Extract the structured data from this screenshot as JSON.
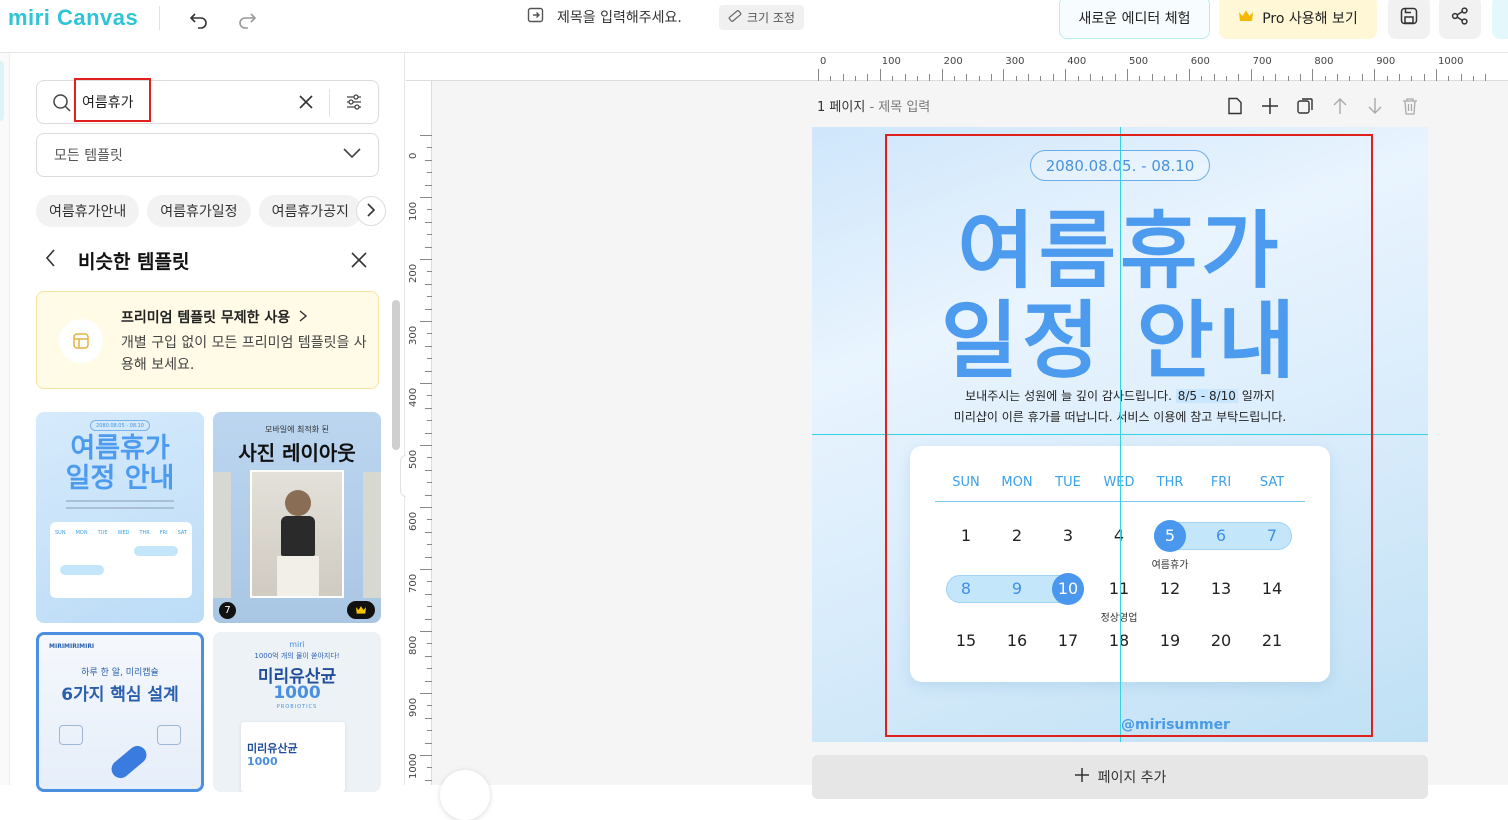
{
  "app": {
    "logo": "miri Canvas"
  },
  "topbar": {
    "doc_title_placeholder": "제목을 입력해주세요.",
    "resize_label": "크기 조정",
    "new_editor_label": "새로운 에디터 체험",
    "pro_label": "Pro 사용해 보기"
  },
  "panel": {
    "search_value": "여름휴가",
    "filter_label": "모든 템플릿",
    "chips": [
      "여름휴가안내",
      "여름휴가일정",
      "여름휴가공지"
    ],
    "similar_title": "비슷한 템플릿",
    "promo_title": "프리미엄 템플릿 무제한 사용",
    "promo_desc": "개별 구입 없이 모든 프리미엄 템플릿을 사용해 보세요.",
    "thumbs": {
      "t1": {
        "date": "2080.08.05 - 08.10",
        "line1": "여름휴가",
        "line2": "일정 안내",
        "days": [
          "SUN",
          "MON",
          "TUE",
          "WED",
          "THR",
          "FRI",
          "SAT"
        ]
      },
      "t2": {
        "top": "모바일에 최적화 된",
        "title": "사진 레이아웃",
        "badge": "7"
      },
      "t3": {
        "brand": "MIRIMIRIMIRI",
        "sub": "하루 한 알, 미리캡슐",
        "title": "6가지 핵심 설계"
      },
      "t4": {
        "brand": "miri",
        "sub": "1000억 개의 물이 쏟아지다!",
        "title": "미리유산균",
        "num": "1000",
        "probio": "PROBIOTICS",
        "pack_title": "미리유산균",
        "pack_num": "1000"
      }
    }
  },
  "rulers": {
    "top": [
      "0",
      "100",
      "200",
      "300",
      "400",
      "500",
      "600",
      "700",
      "800",
      "900",
      "1000"
    ],
    "left": [
      "0",
      "100",
      "200",
      "300",
      "400",
      "500",
      "600",
      "700",
      "800",
      "900",
      "1000"
    ]
  },
  "page": {
    "label": "1 페이지",
    "sub": "- 제목 입력",
    "add_label": "페이지 추가"
  },
  "design": {
    "date": "2080.08.05. - 08.10",
    "line1": "여름휴가",
    "line2": "일정 안내",
    "desc1_pre": "보내주시는 성원에 늘 깊이 감사드립니다. ",
    "desc1_hl": "8/5 - 8/10",
    "desc1_post": " 일까지",
    "desc2": "미리샵이 이른 휴가를 떠납니다. 서비스 이용에 참고 부탁드립니다.",
    "handle": "@mirisummer",
    "calendar": {
      "days": [
        "SUN",
        "MON",
        "TUE",
        "WED",
        "THR",
        "FRI",
        "SAT"
      ],
      "rows": [
        [
          "1",
          "2",
          "3",
          "4",
          "5",
          "6",
          "7"
        ],
        [
          "8",
          "9",
          "10",
          "11",
          "12",
          "13",
          "14"
        ],
        [
          "15",
          "16",
          "17",
          "18",
          "19",
          "20",
          "21"
        ]
      ],
      "note_vacation": "여름휴가",
      "note_resume": "정상영업"
    }
  },
  "colors": {
    "accent": "#2fc4d6",
    "design_blue": "#4d9bef",
    "selection": "#e0201a",
    "guide": "#34d3e2"
  }
}
